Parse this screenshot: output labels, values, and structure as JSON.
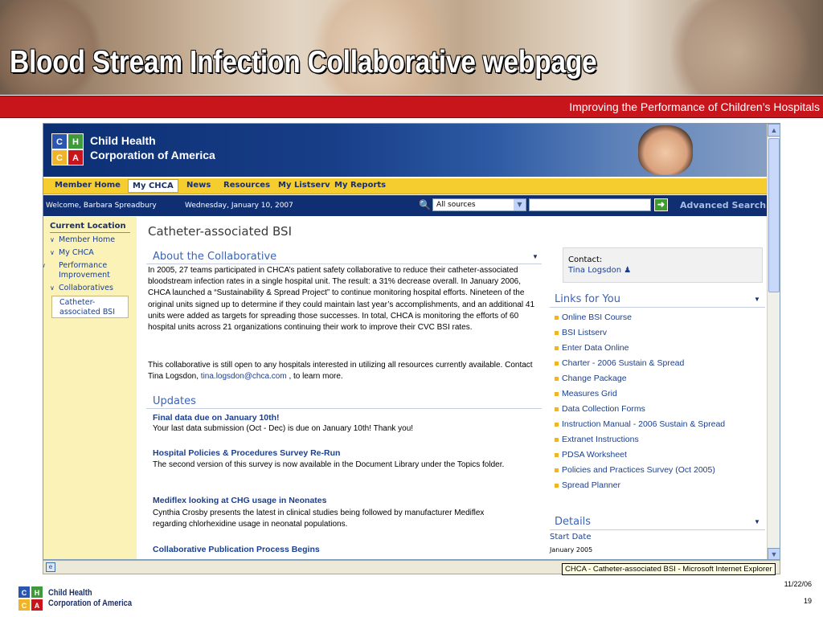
{
  "slide": {
    "title": "Blood Stream Infection Collaborative webpage",
    "tagline": "Improving the Performance of Children’s Hospitals",
    "date": "11/22/06",
    "page_number": "19",
    "footer_org_line1": "Child Health",
    "footer_org_line2": "Corporation of America"
  },
  "site": {
    "org_line1": "Child Health",
    "org_line2": "Corporation of America",
    "logo_letters": [
      "C",
      "H",
      "C",
      "A"
    ],
    "colors": {
      "navy": "#102f72",
      "gold": "#f5cd2f",
      "red": "#c8141b",
      "link": "#1b3f8e",
      "section": "#3a63b8"
    }
  },
  "nav": {
    "items": [
      "Member Home",
      "My CHCA",
      "News",
      "Resources",
      "My Listserv",
      "My Reports"
    ],
    "active": "My CHCA"
  },
  "infobar": {
    "welcome": "Welcome, Barbara Spreadbury",
    "date": "Wednesday, January 10, 2007",
    "source_selected": "All sources",
    "search_value": "",
    "advanced_search": "Advanced Search"
  },
  "sidebar": {
    "title": "Current Location",
    "links": [
      "Member Home",
      "My CHCA",
      "Performance Improvement",
      "Collaboratives"
    ],
    "current": "Catheter-associated BSI"
  },
  "main": {
    "page_title": "Catheter-associated BSI",
    "about_heading": "About the Collaborative",
    "about_para1": "In 2005, 27 teams participated in CHCA’s patient safety collaborative to reduce their catheter-associated bloodstream infection rates in a single hospital unit.  The result: a 31% decrease overall.  In January 2006, CHCA launched a “Sustainability & Spread Project” to continue monitoring hospital efforts.  Nineteen of the original units signed up to determine if they could maintain last year’s accomplishments, and an additional 41 units were added as targets for spreading those successes.  In total, CHCA is monitoring the efforts of 60 hospital units across 21 organizations continuing their work to improve their CVC BSI rates.",
    "about_para2_prefix": "This collaborative is still open to any hospitals interested in utilizing all resources currently available.  Contact Tina Logsdon, ",
    "about_email": "tina.logsdon@chca.com",
    "about_para2_suffix": " , to learn more.",
    "updates_heading": "Updates",
    "updates": [
      {
        "title": "Final data due on January 10th!",
        "body": "Your last data submission (Oct - Dec) is due on January 10th! Thank you!"
      },
      {
        "title": "Hospital Policies & Procedures Survey Re-Run",
        "body": "The second version of this survey is now available in the Document Library under the Topics folder."
      },
      {
        "title": "Mediflex looking at CHG usage in Neonates",
        "body": "Cynthia Crosby presents the latest in clinical studies being followed by manufacturer Mediflex regarding chlorhexidine usage in neonatal populations."
      },
      {
        "title": "Collaborative Publication Process Begins",
        "body": ""
      }
    ]
  },
  "right": {
    "contact_label": "Contact:",
    "contact_name": "Tina Logsdon",
    "links_heading": "Links for You",
    "links": [
      "Online BSI Course",
      "BSI Listserv",
      "Enter Data Online",
      "Charter - 2006 Sustain & Spread",
      "Change Package",
      "Measures Grid",
      "Data Collection Forms",
      "Instruction Manual - 2006 Sustain & Spread",
      "Extranet Instructions",
      "PDSA Worksheet",
      "Policies and Practices Survey (Oct 2005)",
      "Spread Planner"
    ],
    "details_heading": "Details",
    "start_date_label": "Start Date",
    "start_date_value": "January 2005"
  },
  "browser": {
    "status_tooltip": "CHCA - Catheter-associated BSI - Microsoft Internet Explorer"
  }
}
